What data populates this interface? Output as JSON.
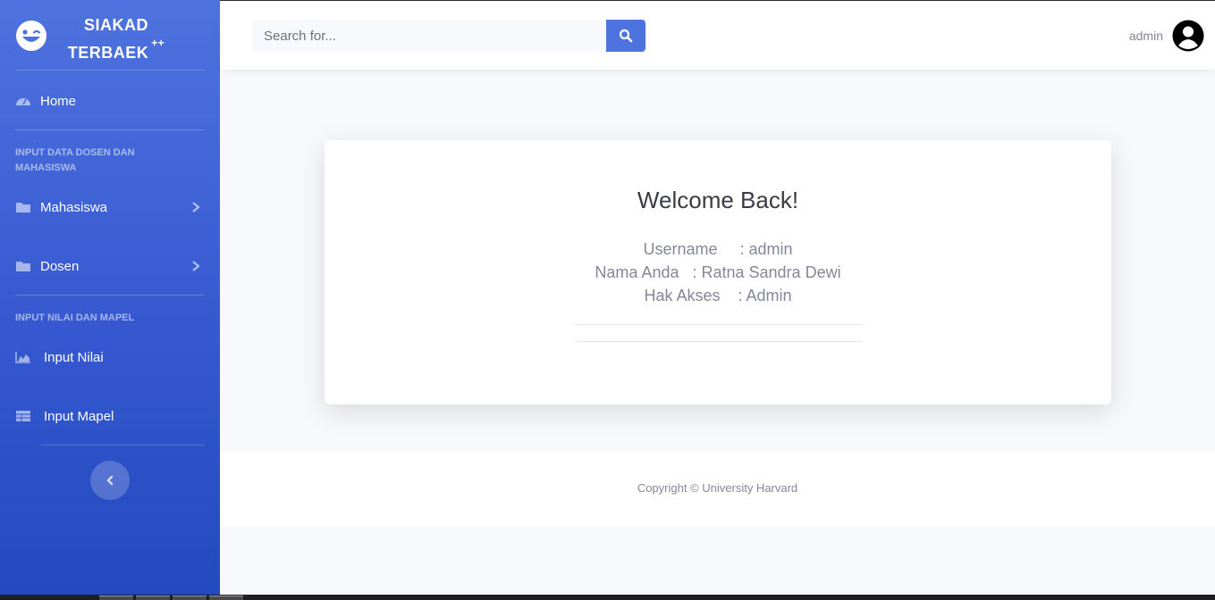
{
  "brand": {
    "line1": "SIAKAD",
    "line2": "TERBAEK",
    "sup": "++",
    "icon": "grin-wink-icon"
  },
  "sidebar": {
    "home": {
      "label": "Home",
      "icon": "tachometer-icon"
    },
    "section1": "INPUT DATA DOSEN DAN MAHASISWA",
    "mahasiswa": {
      "label": "Mahasiswa",
      "icon": "folder-icon"
    },
    "dosen": {
      "label": "Dosen",
      "icon": "folder-icon"
    },
    "section2": "INPUT NILAI DAN MAPEL",
    "input_nilai": {
      "label": "Input Nilai",
      "icon": "chart-area-icon"
    },
    "input_mapel": {
      "label": "Input Mapel",
      "icon": "table-icon"
    }
  },
  "topbar": {
    "search_placeholder": "Search for...",
    "user_name": "admin"
  },
  "card": {
    "title": "Welcome Back!",
    "username_line": "Username     : admin",
    "nama_line": "Nama Anda   : Ratna Sandra Dewi",
    "akses_line": "Hak Akses    : Admin"
  },
  "footer": {
    "copyright": "Copyright © University Harvard"
  },
  "colors": {
    "primary": "#4e73df",
    "primary_dark": "#224abe",
    "text_muted": "#858796",
    "background": "#f8f9fc"
  }
}
